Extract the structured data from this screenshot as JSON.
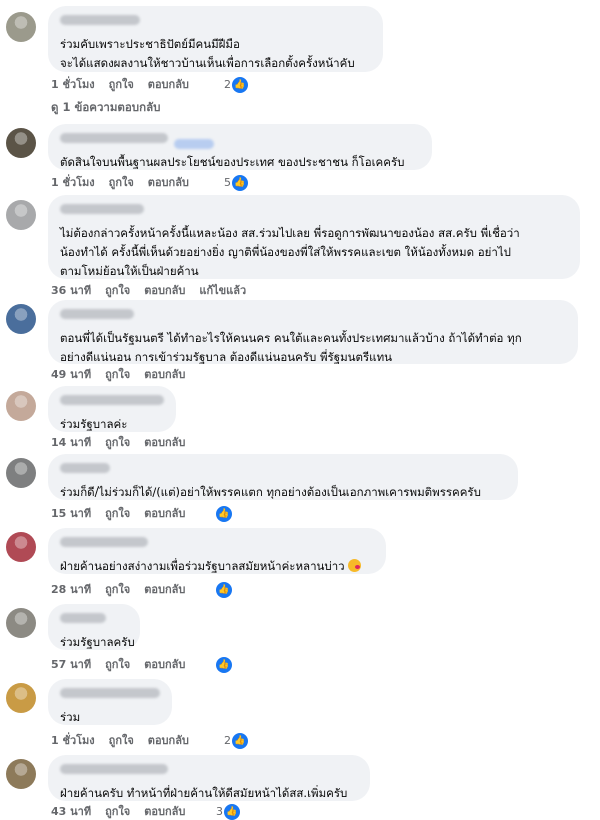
{
  "actions": {
    "like": "ถูกใจ",
    "reply": "ตอบกลับ",
    "edited": "แก้ไขแล้ว"
  },
  "replies_link": "ดู 1 ข้อความตอบกลับ",
  "icons": {
    "like": "thumbs-up-icon",
    "emoji": "smiling-face-with-heart-icon"
  },
  "colors": {
    "bubble": "#f0f2f5",
    "like": "#1877f2",
    "meta": "#65676b"
  },
  "comments": [
    {
      "lines": [
        "ร่วมคับเพราะประชาธิปัตย์มีคนมีฝีมือ",
        "จะได้แสดงผลงานให้ชาวบ้านเห็นเพื่อการเลือกตั้งครั้งหน้าคับ"
      ],
      "time": "1 ชั่วโมง",
      "likes": "2"
    },
    {
      "lines": [
        "ตัดสินใจบนพื้นฐานผลประโยชน์ของประเทศ ของประชาชน ก็โอเคครับ"
      ],
      "time": "1 ชั่วโมง",
      "likes": "5"
    },
    {
      "lines": [
        "ไม่ต้องกล่าวครั้งหน้าครั้งนี้แหละน้อง สส.ร่วมไปเลย พี่รอดูการพัฒนาของน้อง สส.ครับ พี่เชื่อว่า",
        "น้องทำได้ ครั้งนี้พี่เห็นด้วยอย่างยิ่ง ญาติพี่น้องของพี่ใส่ให้พรรคและเขต ให้น้องทั้งหมด อย่าไป",
        "ตามโหม่ย้อนให้เป็นฝ่ายค้าน"
      ],
      "time": "36 นาที",
      "likes": ""
    },
    {
      "lines": [
        "ตอนพี่ได้เป็นรัฐมนตรี ได้ทำอะไรให้คนนคร คนใต้และคนทั้งประเทศมาแล้วบ้าง ถ้าได้ทำต่อ ทุก",
        "อย่างดีแน่นอน การเข้าร่วมรัฐบาล ต้องดีแน่นอนครับ พี่รัฐมนตรีแทน"
      ],
      "time": "49 นาที",
      "likes": ""
    },
    {
      "lines": [
        "ร่วมรัฐบาลค่ะ"
      ],
      "time": "14 นาที",
      "likes": ""
    },
    {
      "lines": [
        "ร่วมก็ดี/ไม่ร่วมก็ได้/(แต่)อย่าให้พรรคแตก ทุกอย่างต้องเป็นเอกภาพเคารพมติพรรคครับ"
      ],
      "time": "15 นาที",
      "likes": ""
    },
    {
      "lines": [
        "ฝ่ายค้านอย่างสง่างามเพื่อร่วมรัฐบาลสมัยหน้าค่ะหลานบ่าว"
      ],
      "time": "28 นาที",
      "likes": ""
    },
    {
      "lines": [
        "ร่วมรัฐบาลครับ"
      ],
      "time": "57 นาที",
      "likes": ""
    },
    {
      "lines": [
        "ร่วม"
      ],
      "time": "1 ชั่วโมง",
      "likes": "2"
    },
    {
      "lines": [
        "ฝ่ายค้านครับ ทำหน้าที่ฝ่ายค้านให้ดีสมัยหน้าได้สส.เพิ่มครับ"
      ],
      "time": "43 นาที",
      "likes": "3"
    }
  ]
}
